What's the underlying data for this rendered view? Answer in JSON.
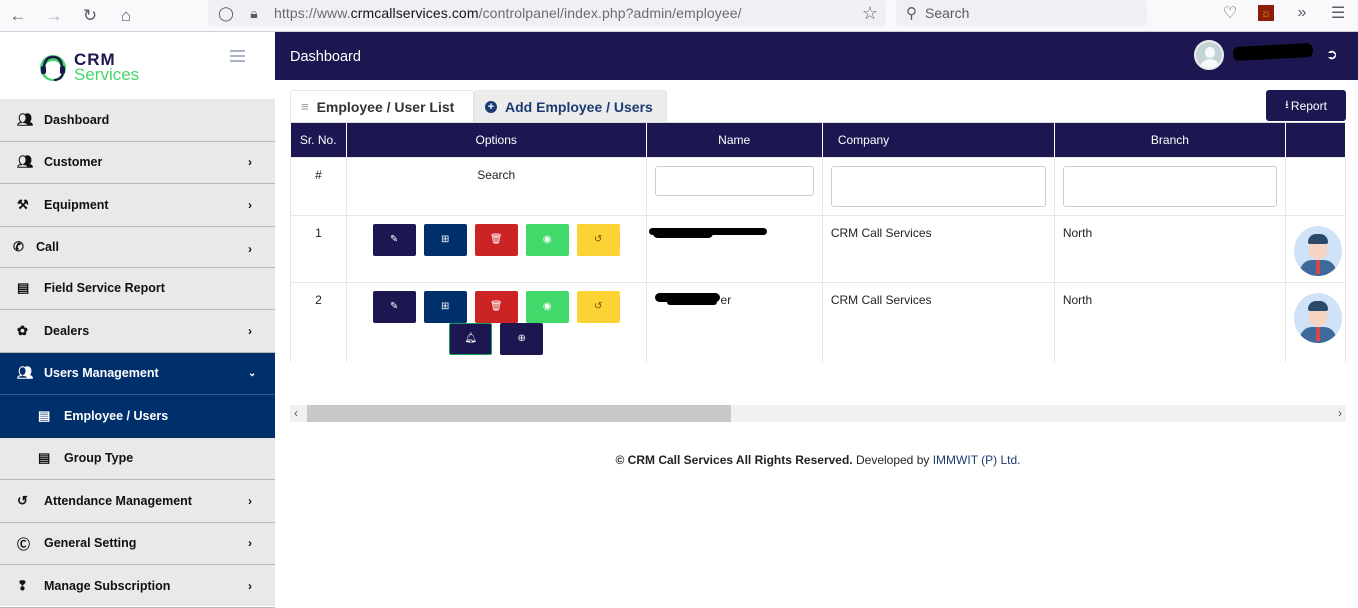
{
  "browser": {
    "url_prefix": "https://www.",
    "url_domain": "crmcallservices.com",
    "url_path": "/controlpanel/index.php?admin/employee/",
    "search_placeholder": "Search"
  },
  "brand": {
    "line1": "CRM",
    "line2": "Services",
    "primary_color": "#1c1750",
    "accent_color": "#43d66a"
  },
  "sidebar": {
    "items": [
      {
        "label": "Dashboard",
        "icon": "users-icon",
        "chevron": false
      },
      {
        "label": "Customer",
        "icon": "users-icon",
        "chevron": true
      },
      {
        "label": "Equipment",
        "icon": "tools-icon",
        "chevron": true
      },
      {
        "label": "Call",
        "icon": "phone-icon",
        "chevron": true
      },
      {
        "label": "Field Service Report",
        "icon": "document-icon",
        "chevron": false
      },
      {
        "label": "Dealers",
        "icon": "leaf-icon",
        "chevron": true
      },
      {
        "label": "Users Management",
        "icon": "users-icon",
        "chevron": true,
        "expanded": true
      },
      {
        "label": "Employee / Users",
        "icon": "document-icon",
        "sub": true,
        "active": true
      },
      {
        "label": "Group Type",
        "icon": "document-icon",
        "sub": true
      },
      {
        "label": "Attendance Management",
        "icon": "history-icon",
        "chevron": true
      },
      {
        "label": "General Setting",
        "icon": "cc-icon",
        "chevron": true
      },
      {
        "label": "Manage Subscription",
        "icon": "lifebuoy-icon",
        "chevron": true
      }
    ]
  },
  "header": {
    "title": "Dashboard",
    "user_name": "[redacted]"
  },
  "tabs": {
    "list_label": "Employee / User List",
    "add_label": "Add Employee / Users"
  },
  "report_label": "Report",
  "table": {
    "columns": [
      "Sr. No.",
      "Options",
      "Name",
      "Company",
      "Branch",
      ""
    ],
    "search_row": {
      "sr": "#",
      "options": "Search"
    },
    "rows": [
      {
        "sr": "1",
        "name": "[redacted]",
        "company": "CRM Call Services",
        "branch": "North",
        "actions": [
          "edit",
          "add",
          "delete",
          "view",
          "history"
        ]
      },
      {
        "sr": "2",
        "name": "[redacted]er",
        "company": "CRM Call Services",
        "branch": "North",
        "actions": [
          "edit",
          "add",
          "delete",
          "view",
          "history",
          "notify",
          "add-more"
        ]
      }
    ]
  },
  "footer": {
    "copyright": "© CRM Call Services All Rights Reserved.",
    "developed_by": "Developed by",
    "developer": "IMMWIT (P) Ltd."
  }
}
